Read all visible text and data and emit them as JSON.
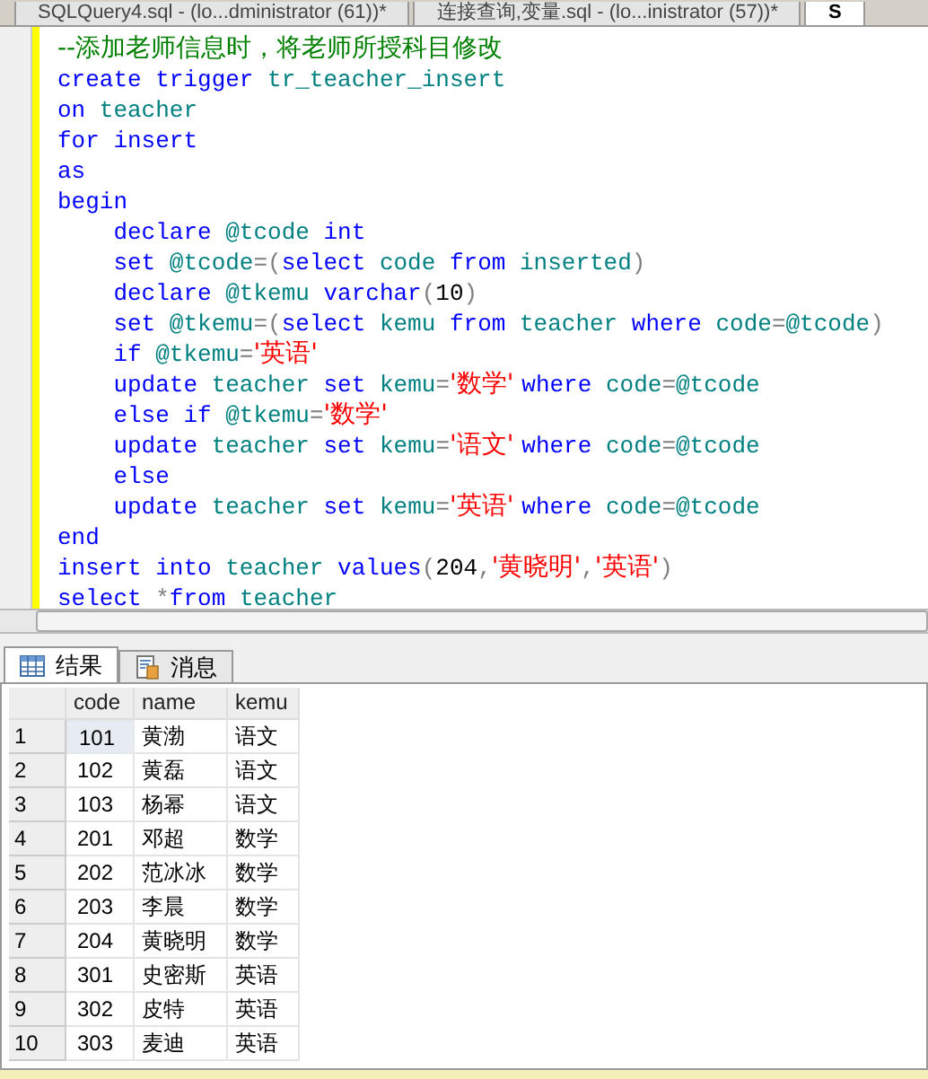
{
  "editor_tabs": [
    {
      "label": "SQLQuery4.sql - (lo...dministrator (61))*",
      "selected": false
    },
    {
      "label": "连接查询,变量.sql - (lo...inistrator (57))*",
      "selected": false
    },
    {
      "label": "S",
      "selected": true
    }
  ],
  "code_lines": [
    {
      "tokens": [
        {
          "kind": "comment",
          "text": "--添加老师信息时，将老师所授科目修改"
        }
      ]
    },
    {
      "tokens": [
        {
          "kind": "keyword",
          "text": "create trigger "
        },
        {
          "kind": "ident",
          "text": "tr_teacher_insert"
        }
      ]
    },
    {
      "tokens": [
        {
          "kind": "keyword",
          "text": "on "
        },
        {
          "kind": "ident",
          "text": "teacher"
        }
      ]
    },
    {
      "tokens": [
        {
          "kind": "keyword",
          "text": "for insert"
        }
      ]
    },
    {
      "tokens": [
        {
          "kind": "keyword",
          "text": "as"
        }
      ]
    },
    {
      "tokens": [
        {
          "kind": "keyword",
          "text": "begin"
        }
      ]
    },
    {
      "tokens": [
        {
          "kind": "keyword",
          "text": "    declare "
        },
        {
          "kind": "ident",
          "text": "@tcode "
        },
        {
          "kind": "keyword",
          "text": "int"
        }
      ]
    },
    {
      "tokens": [
        {
          "kind": "keyword",
          "text": "    set "
        },
        {
          "kind": "ident",
          "text": "@tcode"
        },
        {
          "kind": "op",
          "text": "=("
        },
        {
          "kind": "keyword",
          "text": "select "
        },
        {
          "kind": "ident",
          "text": "code "
        },
        {
          "kind": "keyword",
          "text": "from "
        },
        {
          "kind": "ident",
          "text": "inserted"
        },
        {
          "kind": "op",
          "text": ")"
        }
      ]
    },
    {
      "tokens": [
        {
          "kind": "keyword",
          "text": "    declare "
        },
        {
          "kind": "ident",
          "text": "@tkemu "
        },
        {
          "kind": "keyword",
          "text": "varchar"
        },
        {
          "kind": "op",
          "text": "("
        },
        {
          "kind": "number",
          "text": "10"
        },
        {
          "kind": "op",
          "text": ")"
        }
      ]
    },
    {
      "tokens": [
        {
          "kind": "keyword",
          "text": "    set "
        },
        {
          "kind": "ident",
          "text": "@tkemu"
        },
        {
          "kind": "op",
          "text": "=("
        },
        {
          "kind": "keyword",
          "text": "select "
        },
        {
          "kind": "ident",
          "text": "kemu "
        },
        {
          "kind": "keyword",
          "text": "from "
        },
        {
          "kind": "ident",
          "text": "teacher "
        },
        {
          "kind": "keyword",
          "text": "where "
        },
        {
          "kind": "ident",
          "text": "code"
        },
        {
          "kind": "op",
          "text": "="
        },
        {
          "kind": "ident",
          "text": "@tcode"
        },
        {
          "kind": "op",
          "text": ")"
        }
      ]
    },
    {
      "tokens": [
        {
          "kind": "keyword",
          "text": "    if "
        },
        {
          "kind": "ident",
          "text": "@tkemu"
        },
        {
          "kind": "op",
          "text": "="
        },
        {
          "kind": "string",
          "text": "'英语'"
        }
      ]
    },
    {
      "tokens": [
        {
          "kind": "keyword",
          "text": "    update "
        },
        {
          "kind": "ident",
          "text": "teacher "
        },
        {
          "kind": "keyword",
          "text": "set "
        },
        {
          "kind": "ident",
          "text": "kemu"
        },
        {
          "kind": "op",
          "text": "="
        },
        {
          "kind": "string",
          "text": "'数学' "
        },
        {
          "kind": "keyword",
          "text": "where "
        },
        {
          "kind": "ident",
          "text": "code"
        },
        {
          "kind": "op",
          "text": "="
        },
        {
          "kind": "ident",
          "text": "@tcode"
        }
      ]
    },
    {
      "tokens": [
        {
          "kind": "keyword",
          "text": "    else if "
        },
        {
          "kind": "ident",
          "text": "@tkemu"
        },
        {
          "kind": "op",
          "text": "="
        },
        {
          "kind": "string",
          "text": "'数学'"
        }
      ]
    },
    {
      "tokens": [
        {
          "kind": "keyword",
          "text": "    update "
        },
        {
          "kind": "ident",
          "text": "teacher "
        },
        {
          "kind": "keyword",
          "text": "set "
        },
        {
          "kind": "ident",
          "text": "kemu"
        },
        {
          "kind": "op",
          "text": "="
        },
        {
          "kind": "string",
          "text": "'语文' "
        },
        {
          "kind": "keyword",
          "text": "where "
        },
        {
          "kind": "ident",
          "text": "code"
        },
        {
          "kind": "op",
          "text": "="
        },
        {
          "kind": "ident",
          "text": "@tcode"
        }
      ]
    },
    {
      "tokens": [
        {
          "kind": "keyword",
          "text": "    else"
        }
      ]
    },
    {
      "tokens": [
        {
          "kind": "keyword",
          "text": "    update "
        },
        {
          "kind": "ident",
          "text": "teacher "
        },
        {
          "kind": "keyword",
          "text": "set "
        },
        {
          "kind": "ident",
          "text": "kemu"
        },
        {
          "kind": "op",
          "text": "="
        },
        {
          "kind": "string",
          "text": "'英语' "
        },
        {
          "kind": "keyword",
          "text": "where "
        },
        {
          "kind": "ident",
          "text": "code"
        },
        {
          "kind": "op",
          "text": "="
        },
        {
          "kind": "ident",
          "text": "@tcode"
        }
      ]
    },
    {
      "tokens": [
        {
          "kind": "keyword",
          "text": "end"
        }
      ]
    },
    {
      "tokens": [
        {
          "kind": "keyword",
          "text": "insert into "
        },
        {
          "kind": "ident",
          "text": "teacher "
        },
        {
          "kind": "keyword",
          "text": "values"
        },
        {
          "kind": "op",
          "text": "("
        },
        {
          "kind": "number",
          "text": "204"
        },
        {
          "kind": "op",
          "text": ","
        },
        {
          "kind": "string",
          "text": "'黄晓明'"
        },
        {
          "kind": "op",
          "text": ","
        },
        {
          "kind": "string",
          "text": "'英语'"
        },
        {
          "kind": "op",
          "text": ")"
        }
      ]
    },
    {
      "tokens": [
        {
          "kind": "keyword",
          "text": "select "
        },
        {
          "kind": "op",
          "text": "*"
        },
        {
          "kind": "keyword",
          "text": "from "
        },
        {
          "kind": "ident",
          "text": "teacher"
        }
      ]
    }
  ],
  "result_tabs": [
    {
      "label": "结果",
      "kind": "grid",
      "selected": true
    },
    {
      "label": "消息",
      "kind": "messages",
      "selected": false
    }
  ],
  "table": {
    "columns": [
      "code",
      "name",
      "kemu"
    ],
    "rows": [
      {
        "num": "1",
        "cells": [
          "101",
          "黄渤",
          "语文"
        ],
        "selected": true
      },
      {
        "num": "2",
        "cells": [
          "102",
          "黄磊",
          "语文"
        ],
        "selected": false
      },
      {
        "num": "3",
        "cells": [
          "103",
          "杨幂",
          "语文"
        ],
        "selected": false
      },
      {
        "num": "4",
        "cells": [
          "201",
          "邓超",
          "数学"
        ],
        "selected": false
      },
      {
        "num": "5",
        "cells": [
          "202",
          "范冰冰",
          "数学"
        ],
        "selected": false
      },
      {
        "num": "6",
        "cells": [
          "203",
          "李晨",
          "数学"
        ],
        "selected": false
      },
      {
        "num": "7",
        "cells": [
          "204",
          "黄晓明",
          "数学"
        ],
        "selected": false
      },
      {
        "num": "8",
        "cells": [
          "301",
          "史密斯",
          "英语"
        ],
        "selected": false
      },
      {
        "num": "9",
        "cells": [
          "302",
          "皮特",
          "英语"
        ],
        "selected": false
      },
      {
        "num": "10",
        "cells": [
          "303",
          "麦迪",
          "英语"
        ],
        "selected": false
      }
    ]
  }
}
